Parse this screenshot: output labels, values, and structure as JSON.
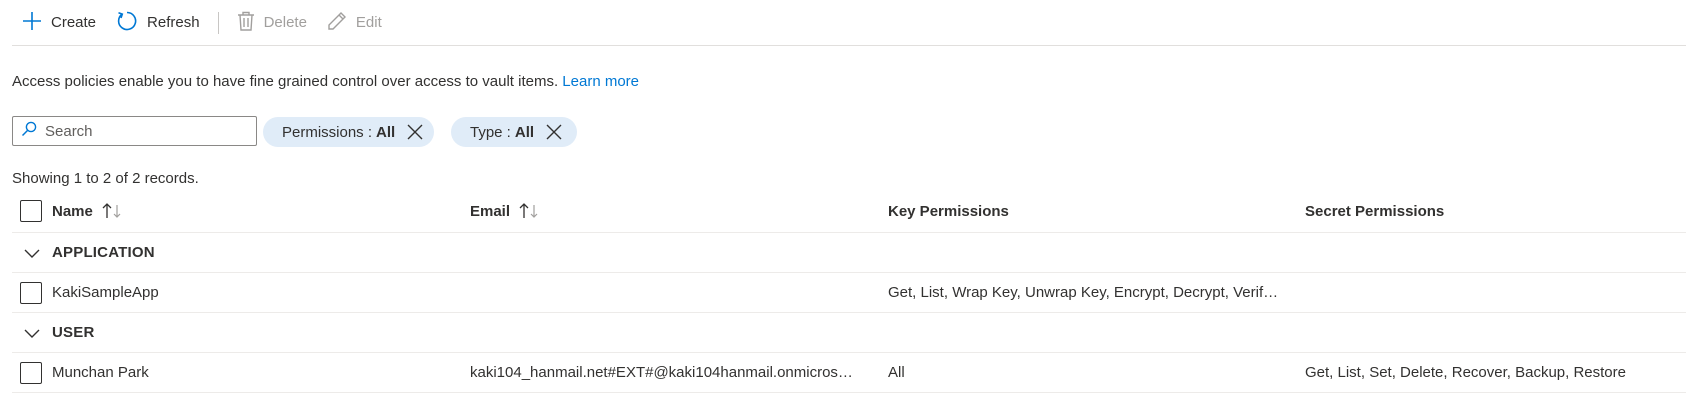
{
  "toolbar": {
    "create_label": "Create",
    "refresh_label": "Refresh",
    "delete_label": "Delete",
    "edit_label": "Edit"
  },
  "description": {
    "text": "Access policies enable you to have fine grained control over access to vault items.",
    "link": "Learn more"
  },
  "search": {
    "placeholder": "Search",
    "value": ""
  },
  "filters": [
    {
      "label": "Permissions :",
      "value": "All"
    },
    {
      "label": "Type :",
      "value": "All"
    }
  ],
  "showing_text": "Showing 1 to 2 of 2 records.",
  "table": {
    "columns": [
      "Name",
      "Email",
      "Key Permissions",
      "Secret Permissions"
    ],
    "groups": [
      {
        "label": "APPLICATION",
        "rows": [
          {
            "name": "KakiSampleApp",
            "email": "",
            "key_permissions": "Get, List, Wrap Key, Unwrap Key, Encrypt, Decrypt, Verif…",
            "secret_permissions": ""
          }
        ]
      },
      {
        "label": "USER",
        "rows": [
          {
            "name": "Munchan Park",
            "email": "kaki104_hanmail.net#EXT#@kaki104hanmail.onmicros…",
            "key_permissions": "All",
            "secret_permissions": "Get, List, Set, Delete, Recover, Backup, Restore"
          }
        ]
      }
    ]
  },
  "colors": {
    "accent": "#0078d4",
    "pill_bg": "#e0ecf8",
    "disabled": "#a19f9d"
  },
  "icons": [
    "plus-icon",
    "refresh-icon",
    "trash-icon",
    "pencil-icon",
    "search-icon",
    "close-icon",
    "sort-icon",
    "chevron-down-icon"
  ]
}
